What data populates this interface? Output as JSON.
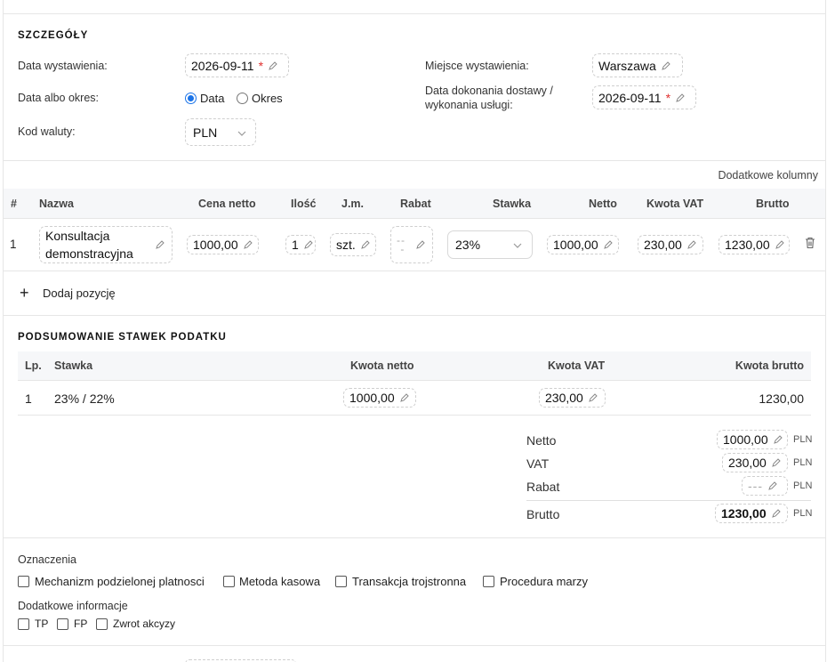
{
  "details": {
    "title": "SZCZEGÓŁY",
    "issue_date_label": "Data wystawienia:",
    "issue_date_value": "2026-09-11",
    "date_or_period_label": "Data albo okres:",
    "radio_date_label": "Data",
    "radio_period_label": "Okres",
    "radio_selected": "Data",
    "currency_label": "Kod waluty:",
    "currency_value": "PLN",
    "place_label": "Miejsce wystawienia:",
    "place_value": "Warszawa",
    "delivery_label_line1": "Data dokonania dostawy /",
    "delivery_label_line2": "wykonania usługi:",
    "delivery_value": "2026-09-11",
    "required_mark": "*"
  },
  "items": {
    "extra_columns_link": "Dodatkowe kolumny",
    "headers": {
      "num": "#",
      "name": "Nazwa",
      "net_price": "Cena netto",
      "qty": "Ilość",
      "unit": "J.m.",
      "discount": "Rabat",
      "rate": "Stawka",
      "net": "Netto",
      "vat": "Kwota VAT",
      "gross": "Brutto"
    },
    "rows": [
      {
        "num": "1",
        "name_line1": "Konsultacja",
        "name_line2": "demonstracyjna",
        "net_price": "1000,00",
        "qty": "1",
        "unit": "szt.",
        "discount": "",
        "rate": "23%",
        "net": "1000,00",
        "vat": "230,00",
        "gross": "1230,00"
      }
    ],
    "add_position_label": "Dodaj pozycję"
  },
  "tax_summary": {
    "title": "PODSUMOWANIE STAWEK PODATKU",
    "headers": {
      "lp": "Lp.",
      "rate": "Stawka",
      "net": "Kwota netto",
      "vat": "Kwota VAT",
      "gross": "Kwota brutto"
    },
    "rows": [
      {
        "lp": "1",
        "rate": "23% / 22%",
        "net": "1000,00",
        "vat": "230,00",
        "gross": "1230,00"
      }
    ]
  },
  "totals": {
    "net_label": "Netto",
    "net_value": "1000,00",
    "vat_label": "VAT",
    "vat_value": "230,00",
    "discount_label": "Rabat",
    "discount_value": "",
    "gross_label": "Brutto",
    "gross_value": "1230,00",
    "currency": "PLN"
  },
  "marks": {
    "title": "Oznaczenia",
    "options": [
      "Mechanizm podzielonej platnosci",
      "Metoda kasowa",
      "Transakcja trojstronna",
      "Procedura marzy"
    ],
    "extra_title": "Dodatkowe informacje",
    "extra_options": [
      "TP",
      "FP",
      "Zwrot akcyzy"
    ]
  },
  "colors": {
    "accent": "#1a73e8",
    "required": "#e0302f",
    "border": "#e6e6e6",
    "header_bg": "#f6f7f9"
  }
}
